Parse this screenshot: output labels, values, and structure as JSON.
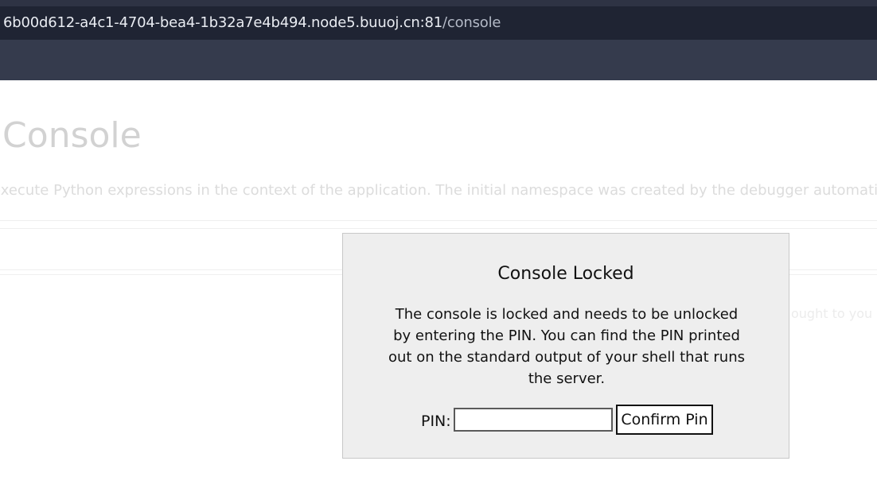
{
  "browser": {
    "url_host": "6b00d612-a4c1-4704-bea4-1b32a7e4b494.node5.buuoj.cn:81",
    "url_path": "/console"
  },
  "page": {
    "title": "e Console",
    "description": " execute Python expressions in the context of the application. The initial namespace was created by the debugger automatically",
    "bg_fragment": "ought to you b"
  },
  "modal": {
    "title": "Console Locked",
    "message": "The console is locked and needs to be unlocked by entering the PIN. You can find the PIN printed out on the standard output of your shell that runs the server.",
    "pin_label": "PIN:",
    "pin_value": "",
    "confirm_label": "Confirm Pin"
  }
}
